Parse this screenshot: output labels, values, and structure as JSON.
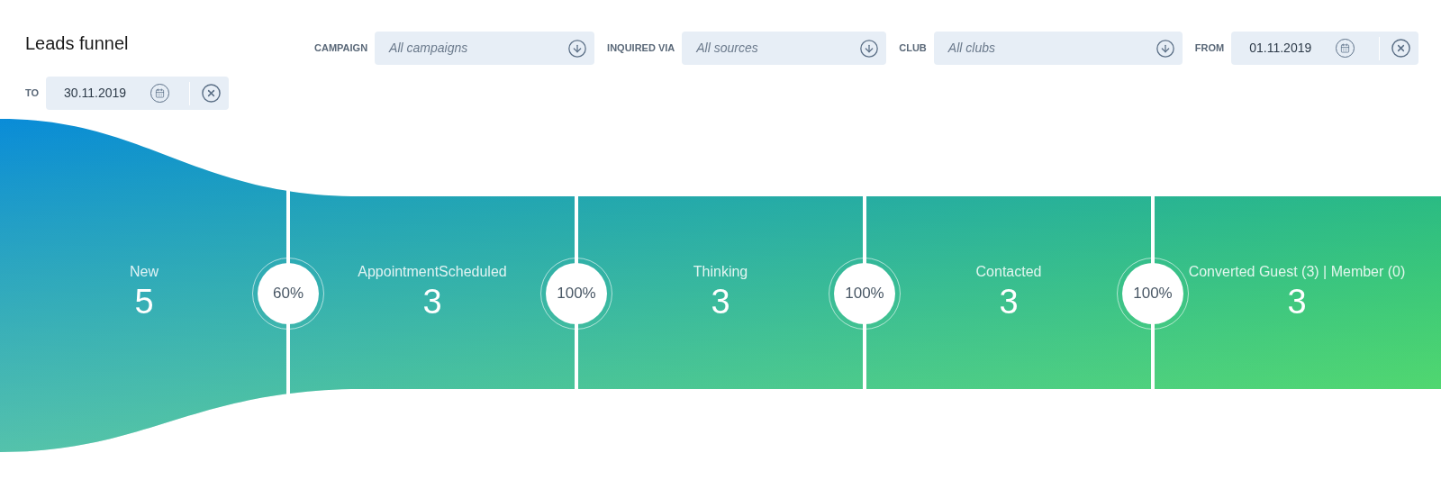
{
  "title": "Leads funnel",
  "filters": [
    {
      "kind": "select",
      "label": "CAMPAIGN",
      "placeholder": "All campaigns"
    },
    {
      "kind": "select",
      "label": "INQUIRED VIA",
      "placeholder": "All sources"
    },
    {
      "kind": "select",
      "label": "CLUB",
      "placeholder": "All clubs"
    },
    {
      "kind": "date",
      "label": "FROM",
      "value": "01.11.2019"
    },
    {
      "kind": "date",
      "label": "TO",
      "value": "30.11.2019"
    }
  ],
  "stages": [
    {
      "label": "New",
      "count": "5"
    },
    {
      "label": "AppointmentScheduled",
      "count": "3",
      "conversion": "60%"
    },
    {
      "label": "Thinking",
      "count": "3",
      "conversion": "100%"
    },
    {
      "label": "Contacted",
      "count": "3",
      "conversion": "100%"
    },
    {
      "label": "Converted Guest (3) | Member (0)",
      "count": "3",
      "conversion": "100%"
    }
  ]
}
